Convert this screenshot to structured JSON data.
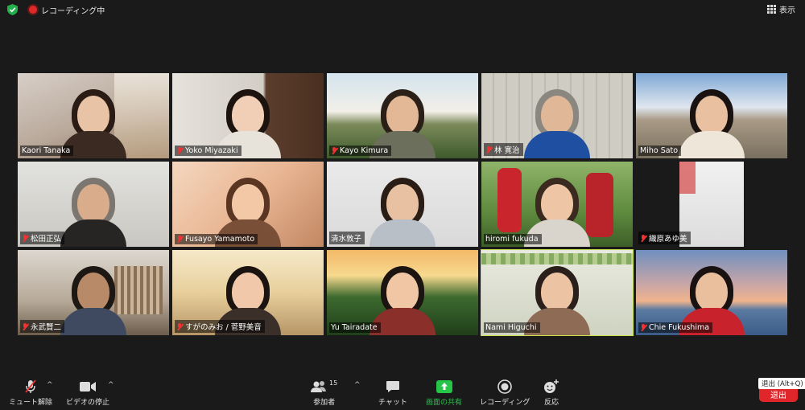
{
  "header": {
    "recording_label": "レコーディング中",
    "view_label": "表示"
  },
  "participants": [
    {
      "name": "Kaori Tanaka",
      "muted": true
    },
    {
      "name": "Yoko Miyazaki",
      "muted": true
    },
    {
      "name": "Kayo Kimura",
      "muted": true
    },
    {
      "name": "林 寛治",
      "muted": true
    },
    {
      "name": "Miho Sato",
      "muted": false
    },
    {
      "name": "松田正弘",
      "muted": true
    },
    {
      "name": "Fusayo Yamamoto",
      "muted": true
    },
    {
      "name": "清水敦子",
      "muted": false
    },
    {
      "name": "hiromi fukuda",
      "muted": false
    },
    {
      "name": "織原あゆ美",
      "muted": true
    },
    {
      "name": "永武賢二",
      "muted": true
    },
    {
      "name": "すがのみお / 菅野美音",
      "muted": true
    },
    {
      "name": "Yu Tairadate",
      "muted": false
    },
    {
      "name": "Nami Higuchi",
      "muted": false
    },
    {
      "name": "Chie Fukushima",
      "muted": true
    }
  ],
  "toolbar": {
    "mute_label": "ミュート解除",
    "video_label": "ビデオの停止",
    "participants_label": "参加者",
    "participants_count": "15",
    "chat_label": "チャット",
    "share_label": "画面の共有",
    "record_label": "レコーディング",
    "reactions_label": "反応",
    "leave_label": "退出",
    "leave_tooltip": "退出 (Alt+Q)"
  },
  "colors": {
    "share_green": "#27c44a",
    "leave_red": "#e0252b",
    "active_speaker": "#c9e34b",
    "muted_red": "#e33333"
  }
}
